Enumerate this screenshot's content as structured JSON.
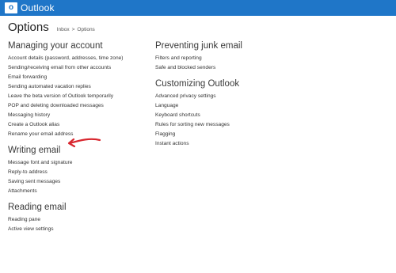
{
  "app": {
    "brand": "Outlook",
    "logo_glyph": "o"
  },
  "header": {
    "title": "Options",
    "breadcrumb": {
      "inbox": "Inbox",
      "separator": ">",
      "current": "Options"
    }
  },
  "left_sections": [
    {
      "title": "Managing your account",
      "items": [
        "Account details (password, addresses, time zone)",
        "Sending/receiving email from other accounts",
        "Email forwarding",
        "Sending automated vacation replies",
        "Leave the beta version of Outlook temporarily",
        "POP and deleting downloaded messages",
        "Messaging history",
        "Create a Outlook alias",
        "Rename your email address"
      ]
    },
    {
      "title": "Writing email",
      "items": [
        "Message font and signature",
        "Reply-to address",
        "Saving sent messages",
        "Attachments"
      ]
    },
    {
      "title": "Reading email",
      "items": [
        "Reading pane",
        "Active view settings"
      ]
    }
  ],
  "right_sections": [
    {
      "title": "Preventing junk email",
      "items": [
        "Filters and reporting",
        "Safe and blocked senders"
      ]
    },
    {
      "title": "Customizing Outlook",
      "items": [
        "Advanced privacy settings",
        "Language",
        "Keyboard shortcuts",
        "Rules for sorting new messages",
        "Flagging",
        "Instant actions"
      ]
    }
  ],
  "colors": {
    "topbar": "#1f76c8",
    "annotation_arrow": "#d8262e"
  }
}
